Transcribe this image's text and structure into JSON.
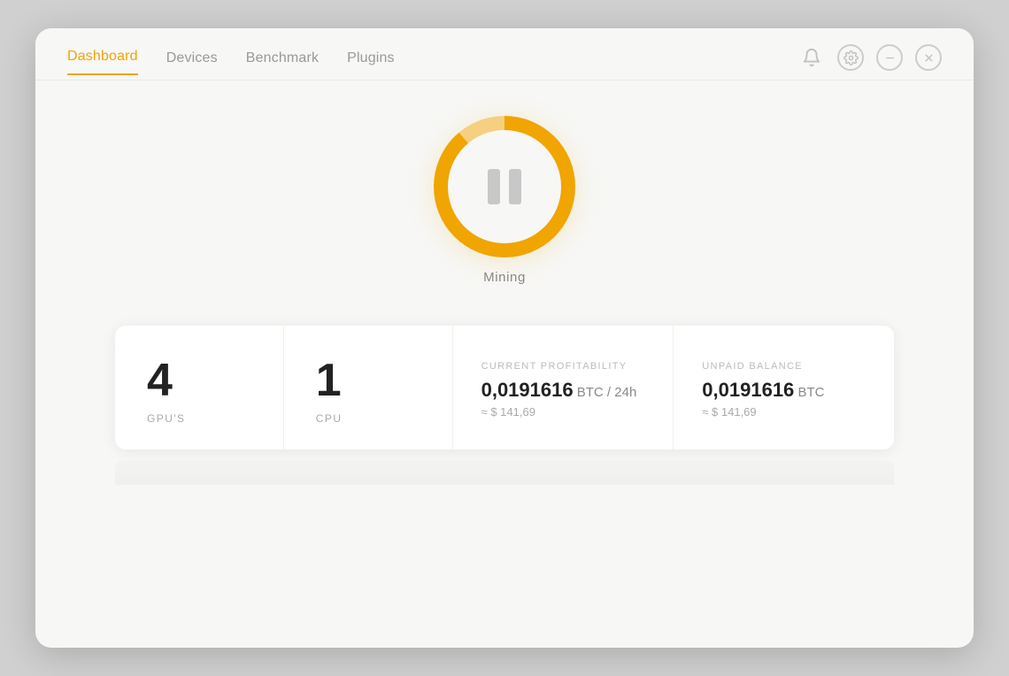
{
  "nav": {
    "items": [
      {
        "id": "dashboard",
        "label": "Dashboard",
        "active": true
      },
      {
        "id": "devices",
        "label": "Devices",
        "active": false
      },
      {
        "id": "benchmark",
        "label": "Benchmark",
        "active": false
      },
      {
        "id": "plugins",
        "label": "Plugins",
        "active": false
      }
    ],
    "icons": {
      "bell": "🔔",
      "settings": "⚙",
      "minimize": "−",
      "close": "✕"
    }
  },
  "mining": {
    "label": "Mining",
    "state": "paused"
  },
  "stats": {
    "gpus": {
      "value": "4",
      "label": "GPU'S"
    },
    "cpu": {
      "value": "1",
      "label": "CPU"
    },
    "profitability": {
      "section_label": "CURRENT PROFITABILITY",
      "value": "0,0191616",
      "unit": " BTC / 24h",
      "sub": "≈ $ 141,69"
    },
    "balance": {
      "section_label": "UNPAID BALANCE",
      "value": "0,0191616",
      "unit": " BTC",
      "sub": "≈ $ 141,69"
    }
  }
}
